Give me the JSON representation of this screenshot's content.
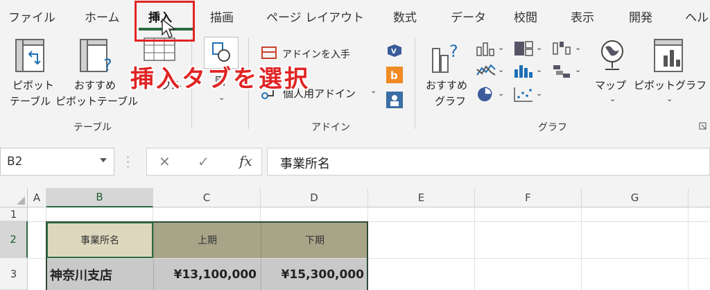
{
  "tabs": [
    "ファイル",
    "ホーム",
    "挿入",
    "描画",
    "ページ レイアウト",
    "数式",
    "データ",
    "校閲",
    "表示",
    "開発",
    "ヘル"
  ],
  "callout": "挿入タブを選択",
  "ribbon": {
    "pivot_table": [
      "ピボット",
      "テーブル"
    ],
    "recommended_pivot": [
      "おすすめ",
      "ピボットテーブル"
    ],
    "table_partial": "ブル",
    "illustrations": "図",
    "get_addins": "アドインを入手",
    "my_addins": "個人用アドイン",
    "recommended_charts": [
      "おすすめ",
      "グラフ"
    ],
    "maps": "マップ",
    "pivot_chart": "ピボットグラフ",
    "groups": {
      "table": "テーブル",
      "addins": "アドイン",
      "charts": "グラフ"
    }
  },
  "formula_bar": {
    "name_box": "B2",
    "fx": "fx",
    "cancel": "✕",
    "enter": "✓",
    "content": "事業所名"
  },
  "grid": {
    "columns": [
      "A",
      "B",
      "C",
      "D",
      "E",
      "F",
      "G"
    ],
    "rows": [
      "1",
      "2",
      "3"
    ],
    "headers": [
      "事業所名",
      "上期",
      "下期"
    ],
    "row3": [
      "神奈川支店",
      "¥13,100,000",
      "¥15,300,000"
    ]
  },
  "colors": {
    "accent": "#2b6a3f",
    "callout": "#e02424",
    "header_b": "#ddd7bd",
    "header_cd": "#a7a488",
    "data_fill": "#c9c9c9"
  }
}
